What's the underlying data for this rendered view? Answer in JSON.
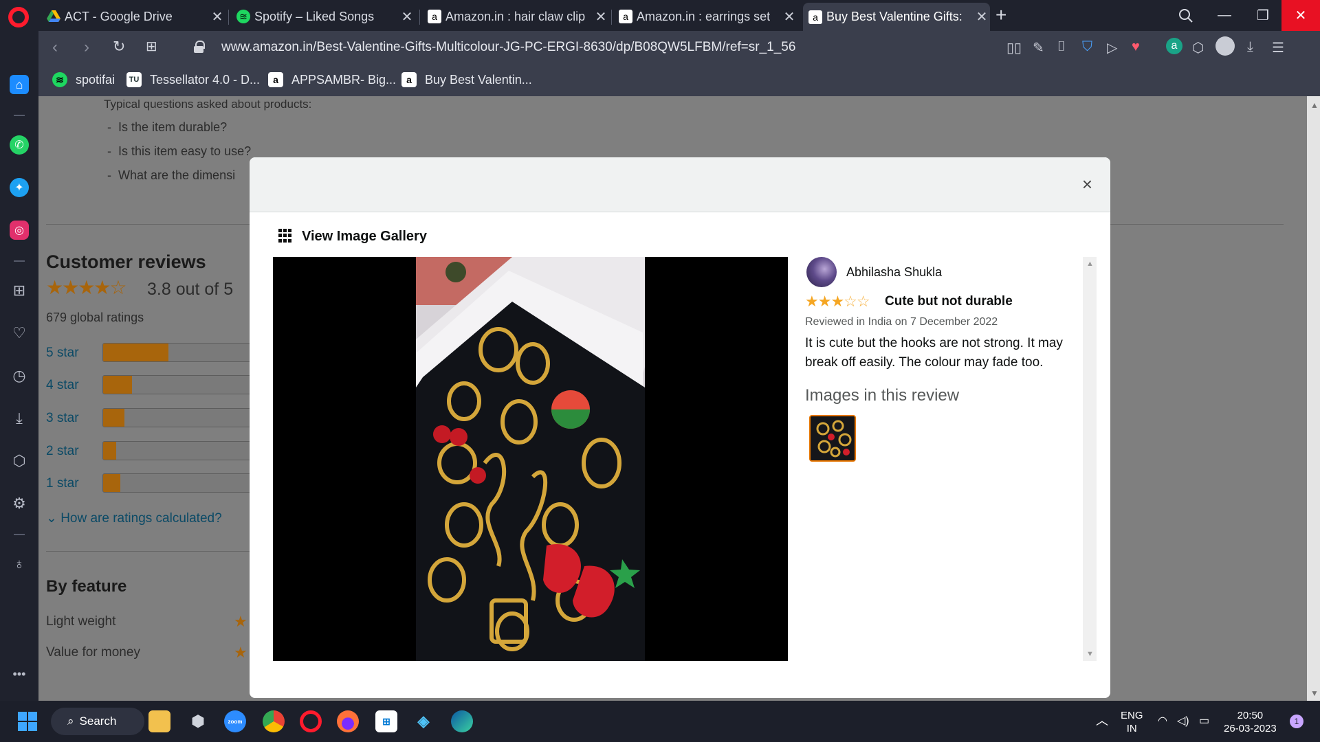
{
  "browser": {
    "tabs": [
      {
        "title": "ACT - Google Drive",
        "icon": "google-drive-icon"
      },
      {
        "title": "Spotify – Liked Songs",
        "icon": "spotify-icon"
      },
      {
        "title": "Amazon.in : hair claw clip",
        "icon": "amazon-icon"
      },
      {
        "title": "Amazon.in : earrings set",
        "icon": "amazon-icon"
      },
      {
        "title": "Buy Best Valentine Gifts:",
        "icon": "amazon-icon",
        "active": true
      }
    ],
    "url": "www.amazon.in/Best-Valentine-Gifts-Multicolour-JG-PC-ERGI-8630/dp/B08QW5LFBM/ref=sr_1_56",
    "bookmarks": [
      {
        "label": "spotifai",
        "icon": "spotify-icon"
      },
      {
        "label": "Tessellator 4.0 - D...",
        "icon": "tessellator-icon"
      },
      {
        "label": "APPSAMBR- Big...",
        "icon": "amazon-icon"
      },
      {
        "label": "Buy Best Valentin...",
        "icon": "amazon-icon"
      }
    ]
  },
  "page": {
    "faq_intro": "Typical questions asked about products:",
    "faq": [
      "Is the item durable?",
      "Is this item easy to use?",
      "What are the dimensi"
    ],
    "reviews_heading": "Customer reviews",
    "average_rating": 3.8,
    "average_text": "3.8 out of 5",
    "global_ratings": "679 global ratings",
    "histogram": [
      {
        "label": "5 star",
        "percent": 34
      },
      {
        "label": "4 star",
        "percent": 15
      },
      {
        "label": "3 star",
        "percent": 11
      },
      {
        "label": "2 star",
        "percent": 7
      },
      {
        "label": "1 star",
        "percent": 9
      }
    ],
    "how_calculated": "How are ratings calculated?",
    "by_feature": "By feature",
    "features": [
      "Light weight",
      "Value for money"
    ]
  },
  "modal": {
    "close": "×",
    "gallery_title": "View Image Gallery",
    "review": {
      "reviewer": "Abhilasha Shukla",
      "stars": 3,
      "title": "Cute but not durable",
      "date": "Reviewed in India on 7 December 2022",
      "body": "It is cute but the hooks are not strong. It may break off easily. The colour may fade too.",
      "images_heading": "Images in this review"
    }
  },
  "taskbar": {
    "search": "Search",
    "lang_top": "ENG",
    "lang_bottom": "IN",
    "time": "20:50",
    "date": "26-03-2023",
    "notifications": "1"
  },
  "colors": {
    "accent_red": "#ff1b2d",
    "star": "#f5a623",
    "page_overlay": "#7f7f7f"
  }
}
